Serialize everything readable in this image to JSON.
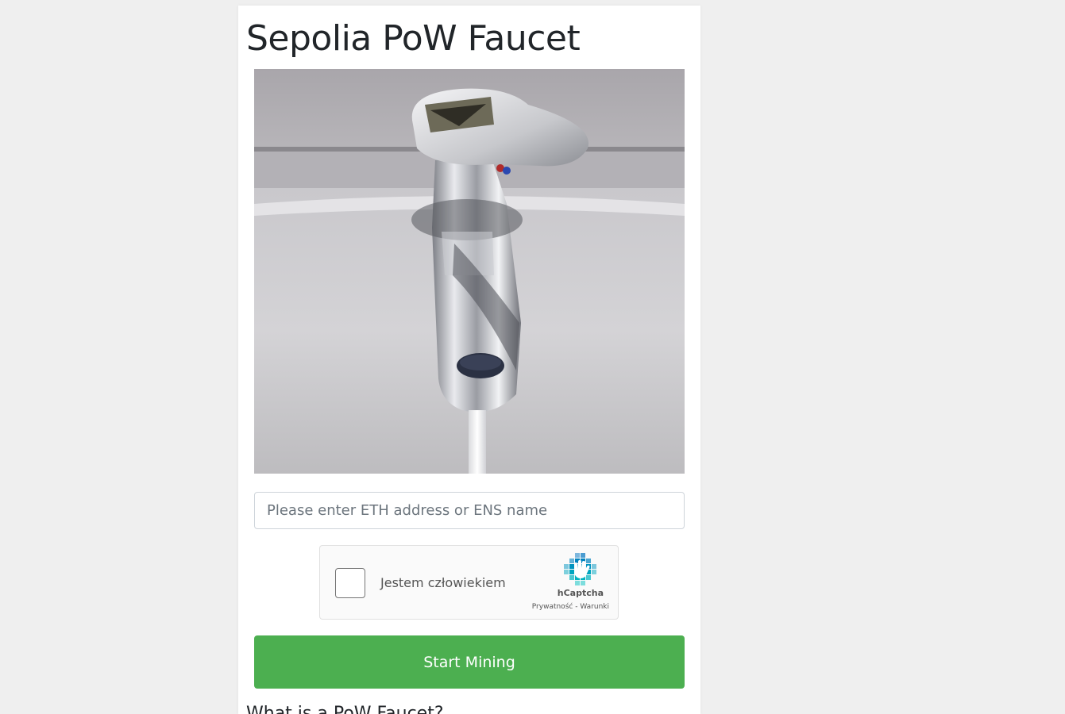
{
  "page": {
    "title": "Sepolia PoW Faucet"
  },
  "form": {
    "address_placeholder": "Please enter ETH address or ENS name",
    "address_value": ""
  },
  "captcha": {
    "label": "Jestem człowiekiem",
    "brand": "hCaptcha",
    "privacy_link": "Prywatność",
    "separator": " - ",
    "terms_link": "Warunki",
    "checked": false
  },
  "actions": {
    "start_label": "Start Mining"
  },
  "info": {
    "heading": "What is a PoW Faucet?"
  },
  "colors": {
    "background": "#efefef",
    "start_button": "#4caf50",
    "title_text": "#212529"
  },
  "icons": {
    "hero": "faucet-image",
    "captcha_logo": "hcaptcha-logo-icon"
  }
}
